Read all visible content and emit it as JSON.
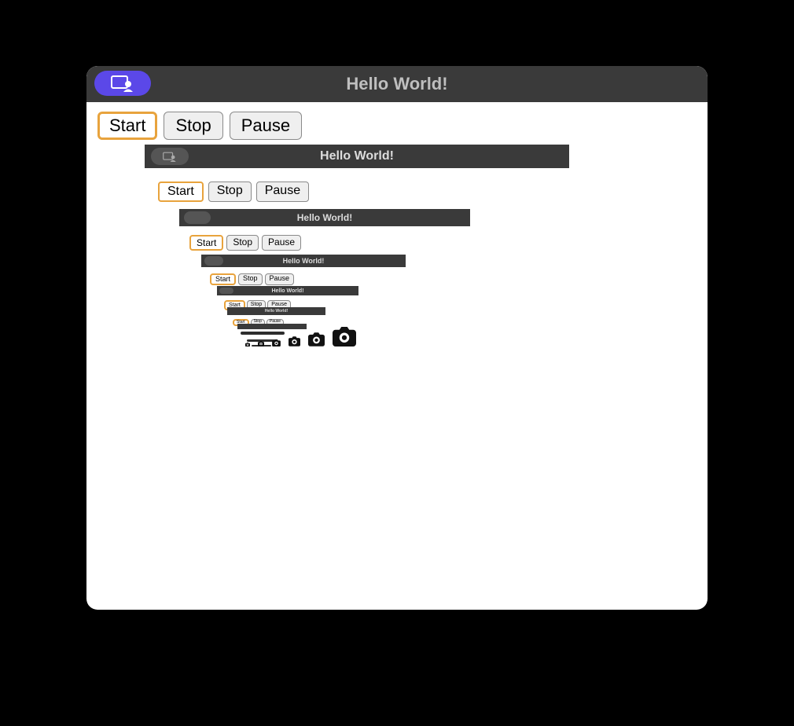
{
  "window": {
    "title": "Hello World!"
  },
  "toolbar": {
    "start_label": "Start",
    "stop_label": "Stop",
    "pause_label": "Pause"
  },
  "icons": {
    "share": "share-screen-person-icon",
    "camera": "camera-icon"
  }
}
